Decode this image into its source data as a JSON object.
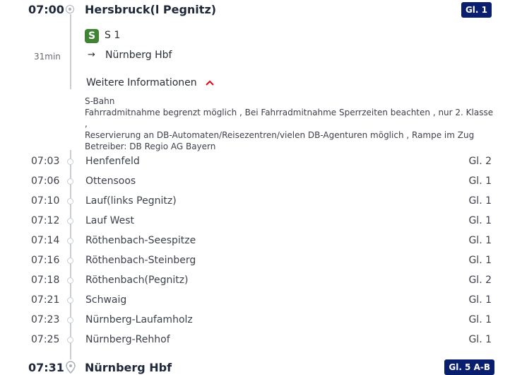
{
  "departure": {
    "time": "07:00",
    "station": "Hersbruck(l Pegnitz)",
    "track": "Gl. 1"
  },
  "train": {
    "badge": "S",
    "line": "S 1",
    "duration": "31min",
    "direction_arrow": "→",
    "destination": "Nürnberg Hbf"
  },
  "more_info": {
    "label": "Weitere Informationen",
    "lines": [
      "S-Bahn",
      "Fahrradmitnahme begrenzt möglich , Bei Fahrradmitnahme Sperrzeiten beachten , nur 2. Klasse ,",
      "Reservierung an DB-Automaten/Reisezentren/vielen DB-Agenturen möglich , Rampe im Zug",
      "Betreiber: DB Regio AG Bayern"
    ]
  },
  "stops": [
    {
      "time": "07:03",
      "name": "Henfenfeld",
      "track": "Gl. 2"
    },
    {
      "time": "07:06",
      "name": "Ottensoos",
      "track": "Gl. 1"
    },
    {
      "time": "07:10",
      "name": "Lauf(links Pegnitz)",
      "track": "Gl. 1"
    },
    {
      "time": "07:12",
      "name": "Lauf West",
      "track": "Gl. 1"
    },
    {
      "time": "07:14",
      "name": "Röthenbach-Seespitze",
      "track": "Gl. 1"
    },
    {
      "time": "07:16",
      "name": "Röthenbach-Steinberg",
      "track": "Gl. 1"
    },
    {
      "time": "07:18",
      "name": "Röthenbach(Pegnitz)",
      "track": "Gl. 2"
    },
    {
      "time": "07:21",
      "name": "Schwaig",
      "track": "Gl. 1"
    },
    {
      "time": "07:23",
      "name": "Nürnberg-Laufamholz",
      "track": "Gl. 1"
    },
    {
      "time": "07:25",
      "name": "Nürnberg-Rehhof",
      "track": "Gl. 1"
    }
  ],
  "arrival": {
    "time": "07:31",
    "station": "Nürnberg Hbf",
    "track": "Gl. 5 A-B"
  },
  "colors": {
    "track_badge_bg": "#0a1e6e",
    "sbahn_green": "#408335",
    "chevron_red": "#ec0016",
    "timeline_grey": "#c8cdd2"
  }
}
